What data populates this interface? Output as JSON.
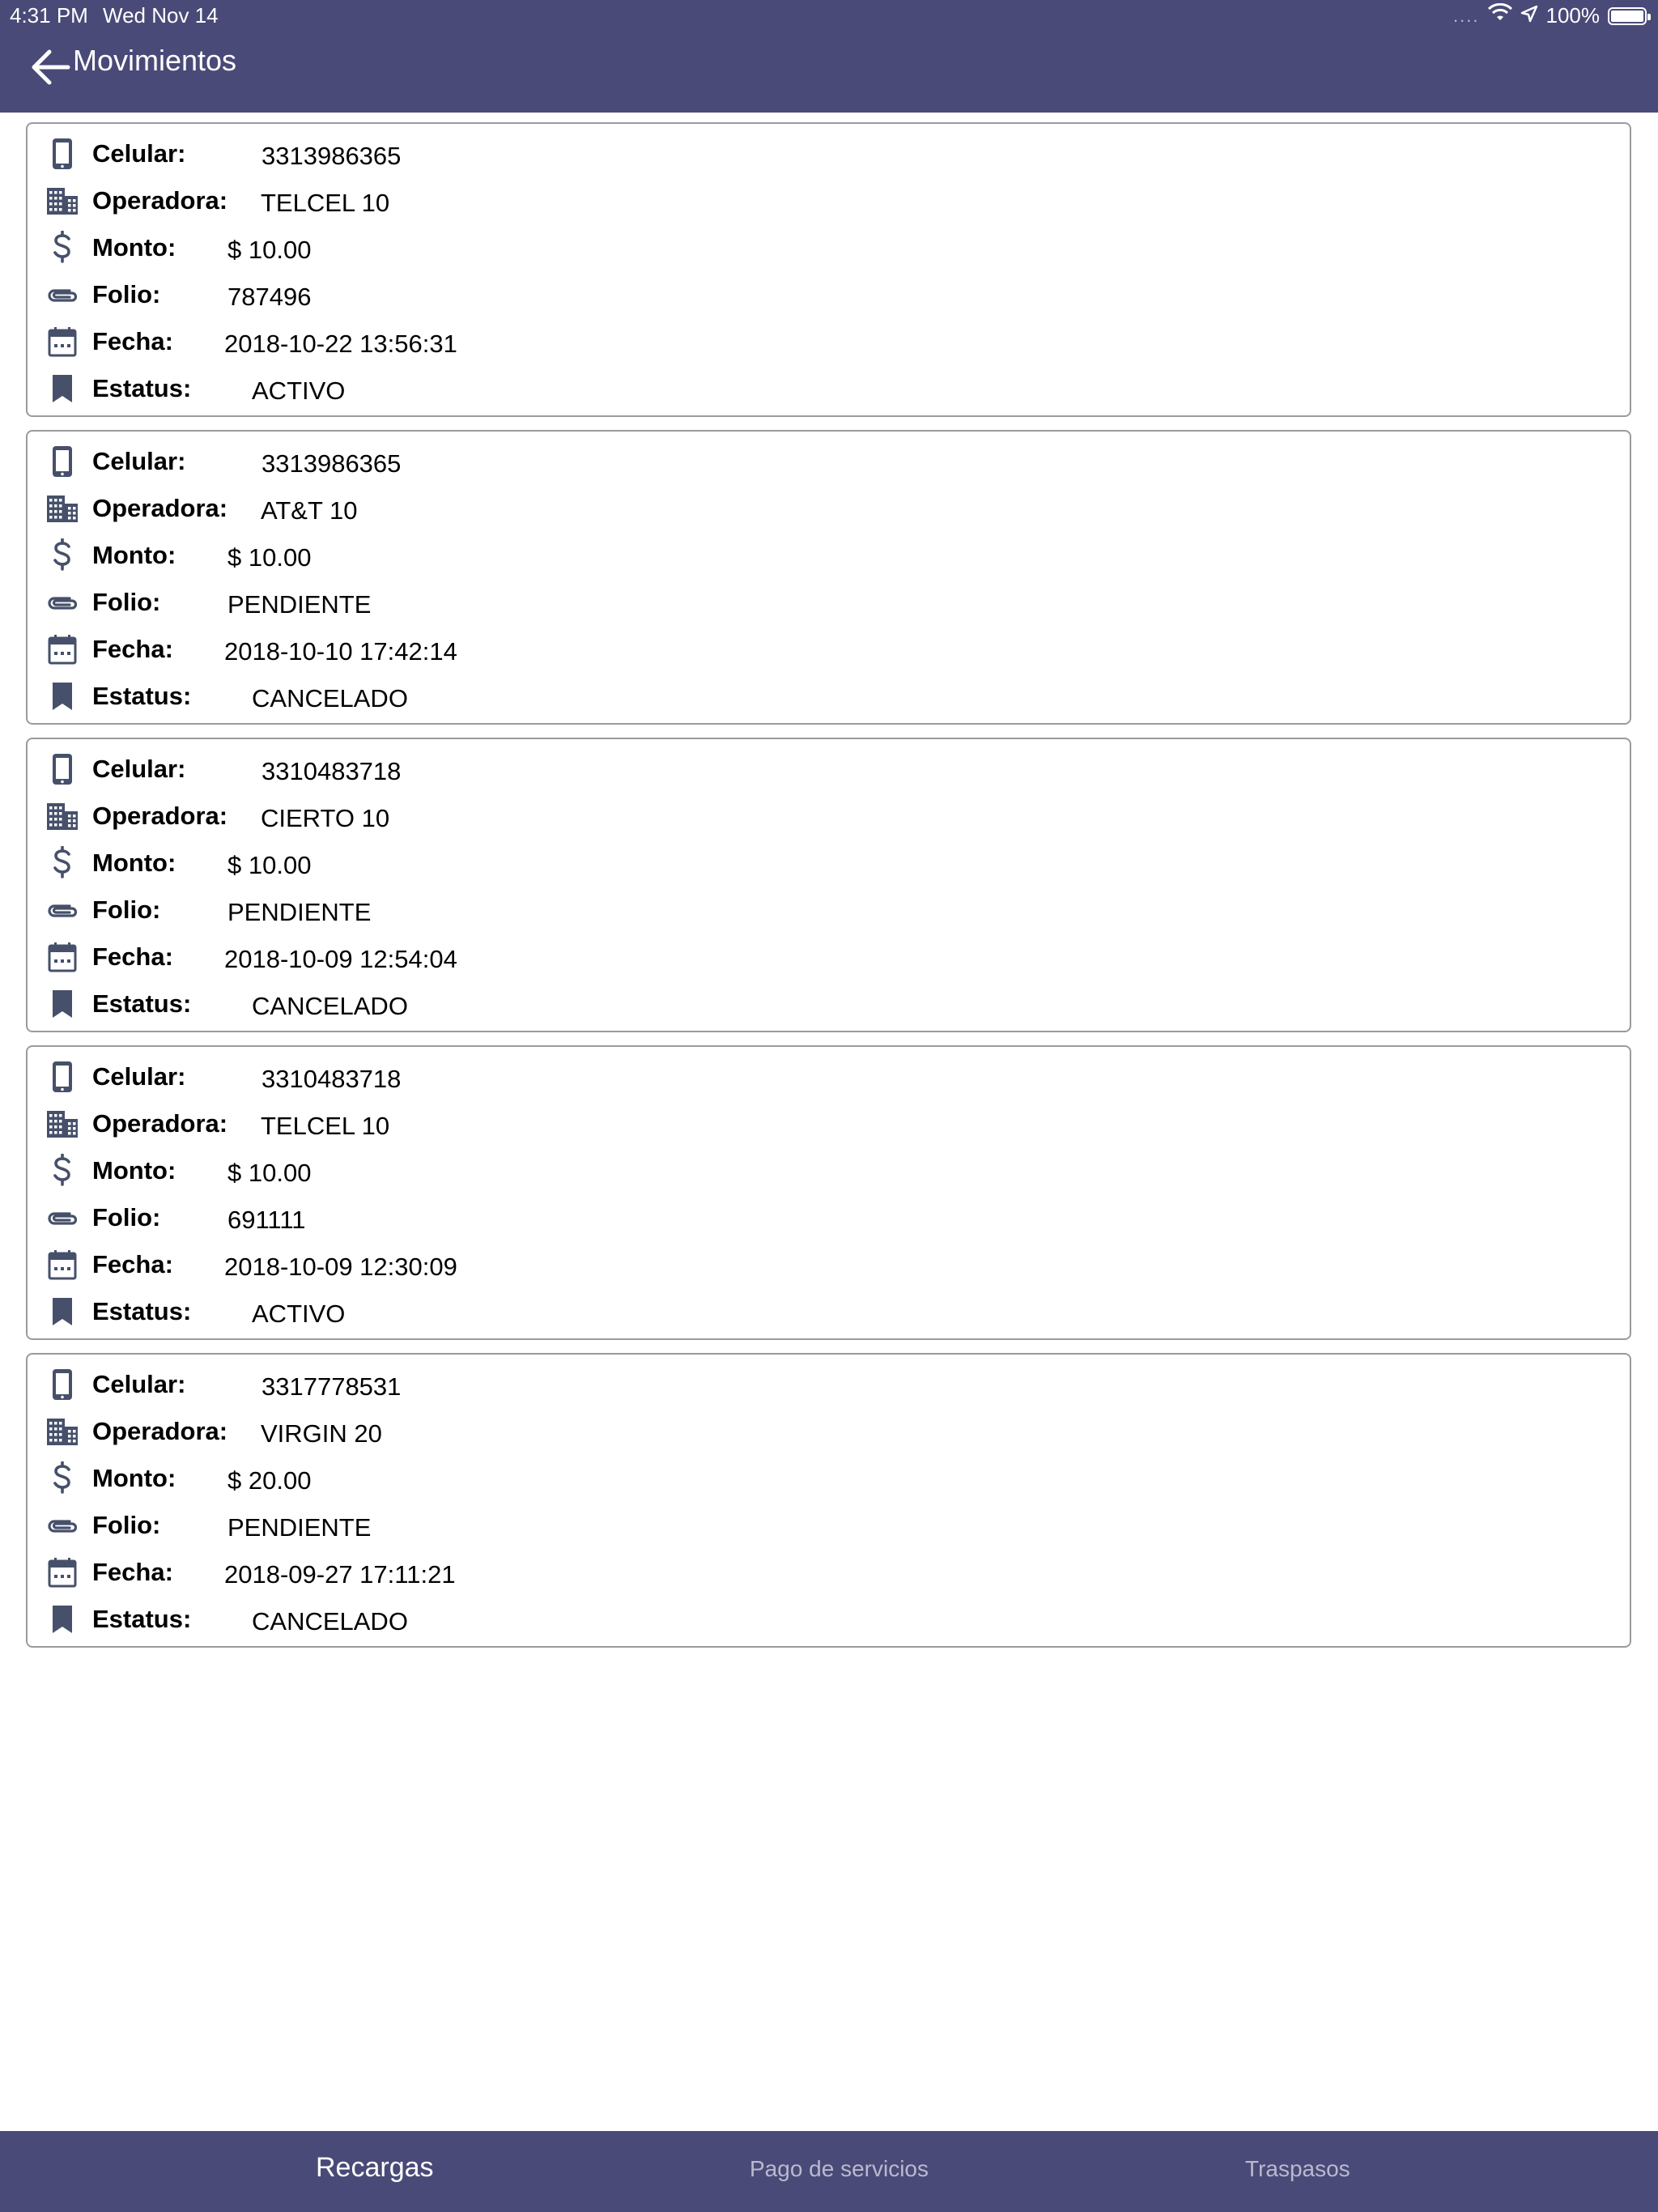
{
  "status_bar": {
    "time": "4:31 PM",
    "date": "Wed Nov 14",
    "signal_dots": "....",
    "battery": "100%"
  },
  "header": {
    "title": "Movimientos",
    "back_icon": "arrow-left-icon"
  },
  "labels": {
    "celular": "Celular:",
    "operadora": "Operadora:",
    "monto": "Monto:",
    "folio": "Folio:",
    "fecha": "Fecha:",
    "estatus": "Estatus:"
  },
  "movimientos": [
    {
      "celular": "3313986365",
      "operadora": "TELCEL 10",
      "monto": "$ 10.00",
      "folio": "787496",
      "fecha": "2018-10-22 13:56:31",
      "estatus": "ACTIVO"
    },
    {
      "celular": "3313986365",
      "operadora": "AT&T 10",
      "monto": "$ 10.00",
      "folio": "PENDIENTE",
      "fecha": "2018-10-10 17:42:14",
      "estatus": "CANCELADO"
    },
    {
      "celular": "3310483718",
      "operadora": "CIERTO 10",
      "monto": "$ 10.00",
      "folio": "PENDIENTE",
      "fecha": "2018-10-09 12:54:04",
      "estatus": "CANCELADO"
    },
    {
      "celular": "3310483718",
      "operadora": "TELCEL 10",
      "monto": "$ 10.00",
      "folio": "691111",
      "fecha": "2018-10-09 12:30:09",
      "estatus": "ACTIVO"
    },
    {
      "celular": "3317778531",
      "operadora": "VIRGIN 20",
      "monto": "$ 20.00",
      "folio": "PENDIENTE",
      "fecha": "2018-09-27 17:11:21",
      "estatus": "CANCELADO"
    }
  ],
  "tabs": [
    {
      "label": "Recargas",
      "active": true
    },
    {
      "label": "Pago de servicios",
      "active": false
    },
    {
      "label": "Traspasos",
      "active": false
    }
  ],
  "colors": {
    "bar": "#4a4a78",
    "icon": "#46506a",
    "card_border": "#9b9b9b",
    "tab_inactive": "#b9b9cf"
  }
}
